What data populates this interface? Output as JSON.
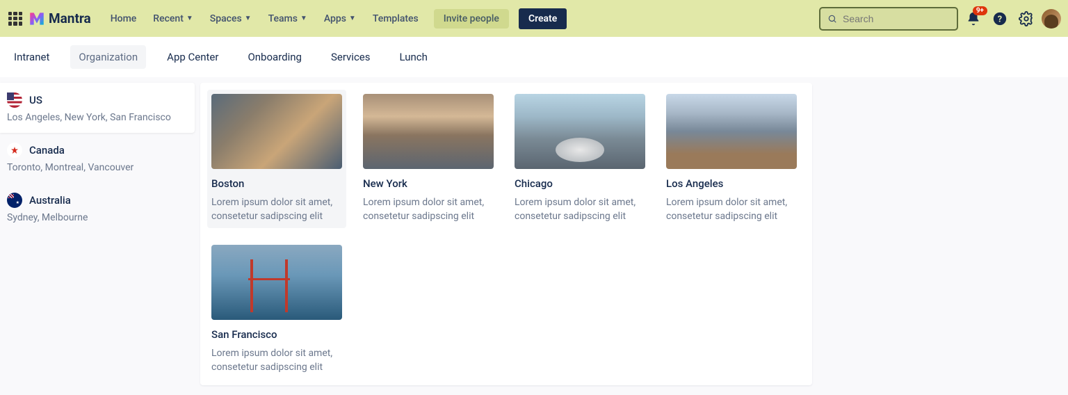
{
  "header": {
    "brand": "Mantra",
    "nav": [
      "Home",
      "Recent",
      "Spaces",
      "Teams",
      "Apps",
      "Templates"
    ],
    "nav_has_chev": [
      false,
      true,
      true,
      true,
      true,
      false
    ],
    "invite_label": "Invite people",
    "create_label": "Create",
    "search_placeholder": "Search",
    "notif_badge": "9+"
  },
  "subnav": {
    "items": [
      "Intranet",
      "Organization",
      "App Center",
      "Onboarding",
      "Services",
      "Lunch"
    ],
    "active_index": 1
  },
  "sidebar": {
    "countries": [
      {
        "name": "US",
        "cities": "Los Angeles, New York, San Francisco",
        "flag": "flag-us",
        "active": true
      },
      {
        "name": "Canada",
        "cities": "Toronto, Montreal, Vancouver",
        "flag": "flag-ca",
        "active": false
      },
      {
        "name": "Australia",
        "cities": "Sydney, Melbourne",
        "flag": "flag-au",
        "active": false
      }
    ]
  },
  "cards": [
    {
      "title": "Boston",
      "desc": "Lorem ipsum dolor sit amet, consetetur sadipscing elit",
      "img": "img-boston",
      "active": true
    },
    {
      "title": "New York",
      "desc": "Lorem ipsum dolor sit amet, consetetur sadipscing elit",
      "img": "img-ny",
      "active": false
    },
    {
      "title": "Chicago",
      "desc": "Lorem ipsum dolor sit amet, consetetur sadipscing elit",
      "img": "img-chi",
      "active": false
    },
    {
      "title": "Los Angeles",
      "desc": "Lorem ipsum dolor sit amet, consetetur sadipscing elit",
      "img": "img-la",
      "active": false
    },
    {
      "title": "San Francisco",
      "desc": "Lorem ipsum dolor sit amet, consetetur sadipscing elit",
      "img": "img-sf",
      "active": false
    }
  ]
}
